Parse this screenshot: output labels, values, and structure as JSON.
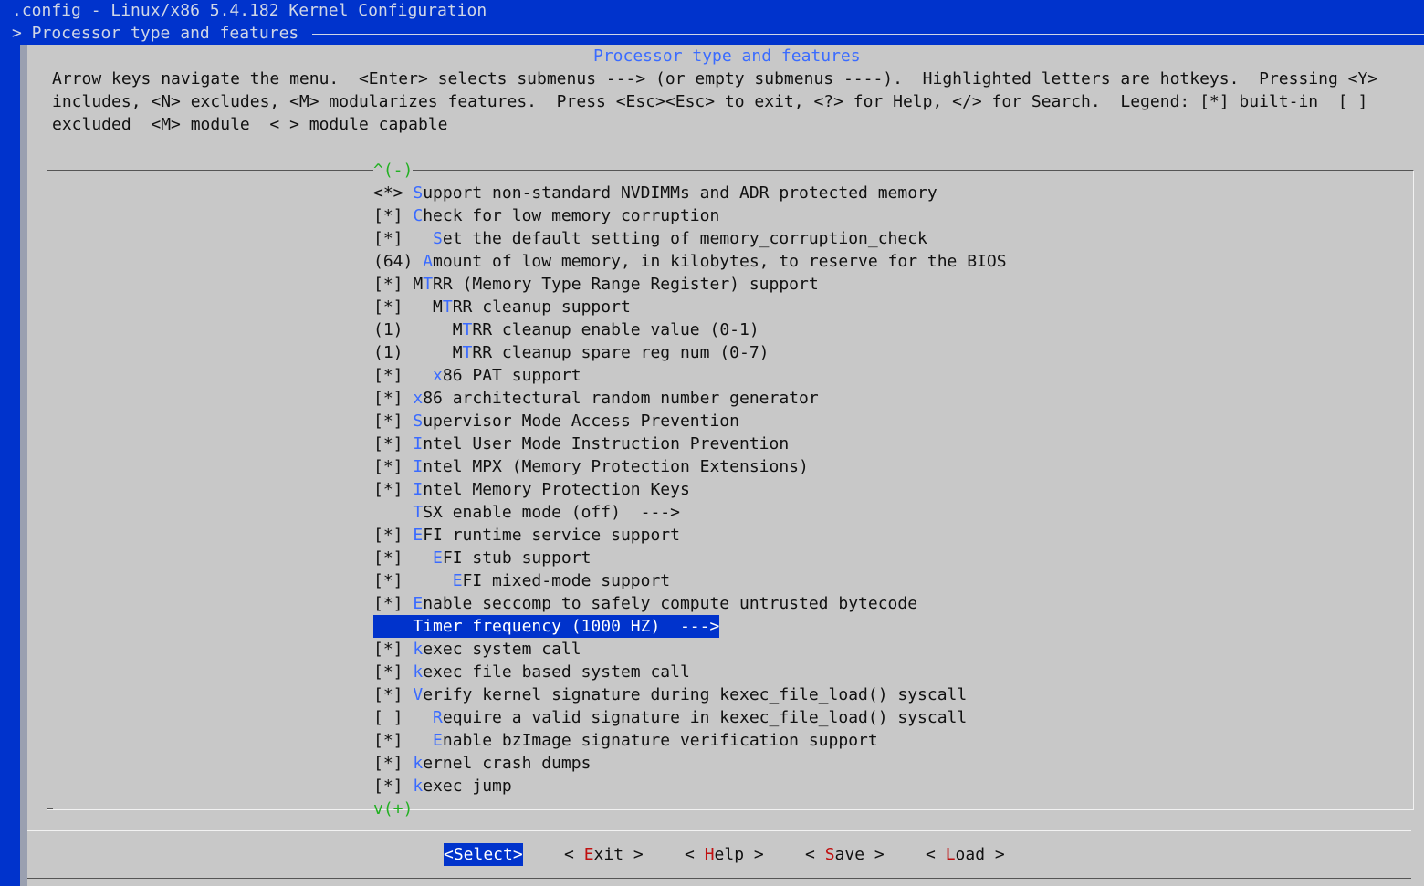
{
  "header": {
    "title": ".config - Linux/x86 5.4.182 Kernel Configuration",
    "breadcrumb": "> Processor type and features"
  },
  "dialog": {
    "title": "Processor type and features",
    "help_lines": [
      "Arrow keys navigate the menu.  <Enter> selects submenus ---> (or empty submenus ----).  Highlighted letters are hotkeys.  Pressing <Y>",
      "includes, <N> excludes, <M> modularizes features.  Press <Esc><Esc> to exit, <?> for Help, </> for Search.  Legend: [*] built-in  [ ]",
      "excluded  <M> module  < > module capable"
    ],
    "scroll_up": "^(-)",
    "scroll_down": "v(+)"
  },
  "menu": {
    "items": [
      {
        "prefix": "<*> ",
        "pre": "",
        "hotkey": "S",
        "rest": "upport non-standard NVDIMMs and ADR protected memory"
      },
      {
        "prefix": "[*] ",
        "pre": "",
        "hotkey": "C",
        "rest": "heck for low memory corruption"
      },
      {
        "prefix": "[*]   ",
        "pre": "",
        "hotkey": "S",
        "rest": "et the default setting of memory_corruption_check"
      },
      {
        "prefix": "(64) ",
        "pre": "",
        "hotkey": "A",
        "rest": "mount of low memory, in kilobytes, to reserve for the BIOS"
      },
      {
        "prefix": "[*] ",
        "pre": "M",
        "hotkey": "T",
        "rest": "RR (Memory Type Range Register) support"
      },
      {
        "prefix": "[*]   ",
        "pre": "M",
        "hotkey": "T",
        "rest": "RR cleanup support"
      },
      {
        "prefix": "(1)     ",
        "pre": "M",
        "hotkey": "T",
        "rest": "RR cleanup enable value (0-1)"
      },
      {
        "prefix": "(1)     ",
        "pre": "M",
        "hotkey": "T",
        "rest": "RR cleanup spare reg num (0-7)"
      },
      {
        "prefix": "[*]   ",
        "pre": "",
        "hotkey": "x",
        "rest": "86 PAT support"
      },
      {
        "prefix": "[*] ",
        "pre": "",
        "hotkey": "x",
        "rest": "86 architectural random number generator"
      },
      {
        "prefix": "[*] ",
        "pre": "",
        "hotkey": "S",
        "rest": "upervisor Mode Access Prevention"
      },
      {
        "prefix": "[*] ",
        "pre": "",
        "hotkey": "I",
        "rest": "ntel User Mode Instruction Prevention"
      },
      {
        "prefix": "[*] ",
        "pre": "",
        "hotkey": "I",
        "rest": "ntel MPX (Memory Protection Extensions)"
      },
      {
        "prefix": "[*] ",
        "pre": "",
        "hotkey": "I",
        "rest": "ntel Memory Protection Keys"
      },
      {
        "prefix": "    ",
        "pre": "",
        "hotkey": "T",
        "rest": "SX enable mode (off)  --->"
      },
      {
        "prefix": "[*] ",
        "pre": "",
        "hotkey": "E",
        "rest": "FI runtime service support"
      },
      {
        "prefix": "[*]   ",
        "pre": "",
        "hotkey": "E",
        "rest": "FI stub support"
      },
      {
        "prefix": "[*]     ",
        "pre": "",
        "hotkey": "E",
        "rest": "FI mixed-mode support"
      },
      {
        "prefix": "[*] ",
        "pre": "",
        "hotkey": "E",
        "rest": "nable seccomp to safely compute untrusted bytecode"
      },
      {
        "prefix": "    ",
        "pre": "",
        "hotkey": "T",
        "rest": "imer frequency (1000 HZ)  --->",
        "selected": true
      },
      {
        "prefix": "[*] ",
        "pre": "",
        "hotkey": "k",
        "rest": "exec system call"
      },
      {
        "prefix": "[*] ",
        "pre": "",
        "hotkey": "k",
        "rest": "exec file based system call"
      },
      {
        "prefix": "[*] ",
        "pre": "",
        "hotkey": "V",
        "rest": "erify kernel signature during kexec_file_load() syscall"
      },
      {
        "prefix": "[ ]   ",
        "pre": "",
        "hotkey": "R",
        "rest": "equire a valid signature in kexec_file_load() syscall"
      },
      {
        "prefix": "[*]   ",
        "pre": "",
        "hotkey": "E",
        "rest": "nable bzImage signature verification support"
      },
      {
        "prefix": "[*] ",
        "pre": "",
        "hotkey": "k",
        "rest": "ernel crash dumps"
      },
      {
        "prefix": "[*] ",
        "pre": "",
        "hotkey": "k",
        "rest": "exec jump"
      }
    ]
  },
  "buttons": {
    "select": "<Select>",
    "exit": {
      "open": "< ",
      "hotkey": "E",
      "rest": "xit",
      "close": " >"
    },
    "help": {
      "open": "< ",
      "hotkey": "H",
      "rest": "elp",
      "close": " >"
    },
    "save": {
      "open": "< ",
      "hotkey": "S",
      "rest": "ave",
      "close": " >"
    },
    "load": {
      "open": "< ",
      "hotkey": "L",
      "rest": "oad",
      "close": " >"
    }
  },
  "colors": {
    "background": "#0033cc",
    "dialog": "#c8c8c8",
    "menu_hotkey": "#3a6bff",
    "button_hotkey": "#c01010",
    "scroll_indicator": "#22b022"
  }
}
